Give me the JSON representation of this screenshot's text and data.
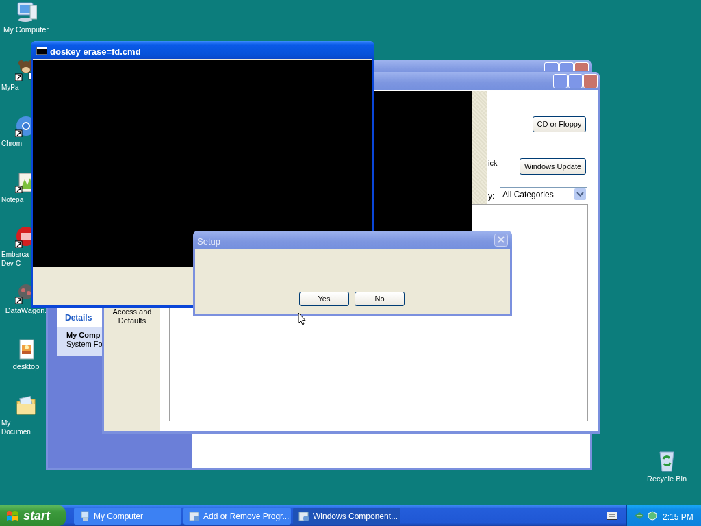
{
  "desktop_icons": [
    {
      "label": "My Computer",
      "kind": "computer",
      "shortcut": false,
      "clipped": false
    },
    {
      "label": "MyPa",
      "kind": "mascot",
      "shortcut": true,
      "clipped": true
    },
    {
      "label": "Chrom",
      "kind": "browser",
      "shortcut": true,
      "clipped": true
    },
    {
      "label": "Notepa",
      "kind": "notepad",
      "shortcut": true,
      "clipped": true
    },
    {
      "label": "Embarca Dev-C",
      "kind": "devcpp",
      "shortcut": true,
      "clipped": true
    },
    {
      "label": "DataWagon.",
      "kind": "wagon",
      "shortcut": true,
      "clipped": false
    },
    {
      "label": "desktop",
      "kind": "image",
      "shortcut": false,
      "clipped": false
    },
    {
      "label": "My Documen",
      "kind": "folder",
      "shortcut": false,
      "clipped": true
    }
  ],
  "recycle_bin": {
    "label": "Recycle Bin"
  },
  "my_computer_window": {
    "active": false,
    "details": {
      "heading": "Details",
      "name": "My Comp",
      "type": "System Fo"
    }
  },
  "components_window": {
    "active": false,
    "sidebar_label": "Access and Defaults",
    "partial_text": "ick",
    "buttons": [
      "CD or Floppy",
      "Windows Update"
    ],
    "category": {
      "label": "y:",
      "value": "All Categories"
    }
  },
  "console_window": {
    "active": true,
    "title": "doskey erase=fd.cmd"
  },
  "setup_dialog": {
    "active": false,
    "title": "Setup",
    "buttons": [
      "Yes",
      "No"
    ]
  },
  "taskbar": {
    "start": "start",
    "tasks": [
      {
        "label": "My Computer",
        "selected": false
      },
      {
        "label": "Add or Remove Progr...",
        "selected": false
      },
      {
        "label": "Windows Component...",
        "selected": true
      }
    ],
    "clock": "2:15 PM"
  }
}
